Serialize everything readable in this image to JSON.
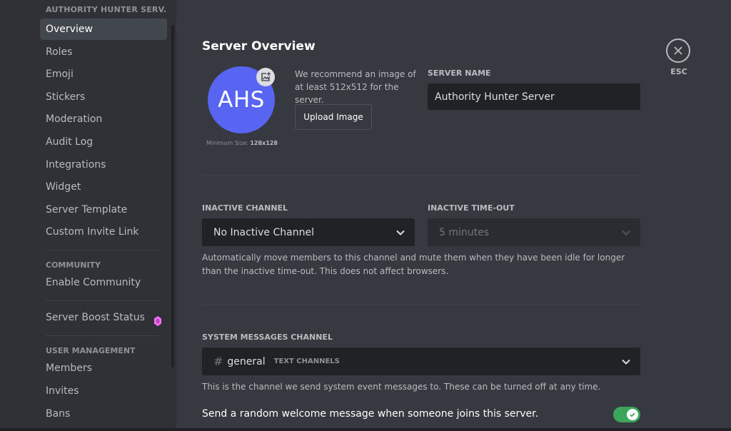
{
  "sidebar": {
    "header": "AUTHORITY HUNTER SERV...",
    "items": [
      {
        "label": "Overview",
        "active": true
      },
      {
        "label": "Roles"
      },
      {
        "label": "Emoji"
      },
      {
        "label": "Stickers"
      },
      {
        "label": "Moderation"
      },
      {
        "label": "Audit Log"
      },
      {
        "label": "Integrations"
      },
      {
        "label": "Widget"
      },
      {
        "label": "Server Template"
      },
      {
        "label": "Custom Invite Link"
      }
    ],
    "community_section": "COMMUNITY",
    "community_items": [
      {
        "label": "Enable Community"
      }
    ],
    "boost_item": {
      "label": "Server Boost Status",
      "icon": "boost-gem-icon",
      "color": "#ff73fa"
    },
    "user_mgmt_section": "USER MANAGEMENT",
    "user_mgmt_items": [
      {
        "label": "Members"
      },
      {
        "label": "Invites"
      },
      {
        "label": "Bans"
      }
    ]
  },
  "main": {
    "title": "Server Overview",
    "avatar": {
      "initials": "AHS",
      "color": "#5865f2",
      "upload_icon": "image-plus-icon"
    },
    "min_size_label": "Minimum Size:",
    "min_size_value": "128x128",
    "recommend_text": "We recommend an image of at least 512x512 for the server.",
    "upload_button": "Upload Image",
    "server_name_label": "SERVER NAME",
    "server_name_value": "Authority Hunter Server",
    "inactive_channel_label": "INACTIVE CHANNEL",
    "inactive_channel_value": "No Inactive Channel",
    "inactive_timeout_label": "INACTIVE TIME-OUT",
    "inactive_timeout_value": "5 minutes",
    "inactive_help": "Automatically move members to this channel and mute them when they have been idle for longer than the inactive time-out. This does not affect browsers.",
    "system_channel_label": "SYSTEM MESSAGES CHANNEL",
    "system_channel_value": "general",
    "system_channel_category": "TEXT CHANNELS",
    "system_help": "This is the channel we send system event messages to. These can be turned off at any time.",
    "welcome_toggle_label": "Send a random welcome message when someone joins this server.",
    "welcome_toggle_on": true,
    "toggle_color": "#3ba55c"
  },
  "close": {
    "label": "ESC"
  }
}
